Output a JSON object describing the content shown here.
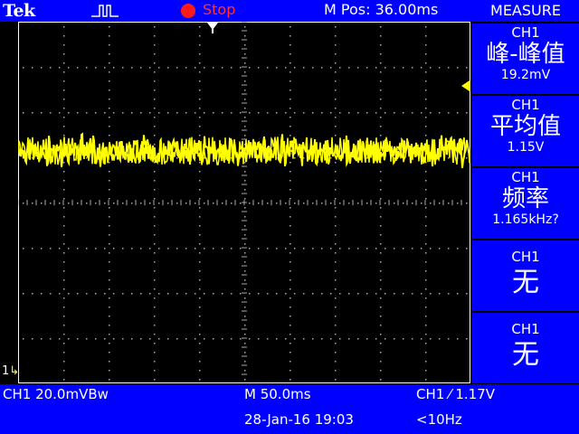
{
  "header": {
    "brand": "Tek",
    "trigger_state": "Stop",
    "position": "M Pos: 36.00ms"
  },
  "measure": {
    "title": "MEASURE",
    "items": [
      {
        "channel": "CH1",
        "label": "峰-峰值",
        "value": "19.2mV"
      },
      {
        "channel": "CH1",
        "label": "平均值",
        "value": "1.15V"
      },
      {
        "channel": "CH1",
        "label": "频率",
        "value": "1.165kHz?"
      },
      {
        "channel": "CH1",
        "label": "无",
        "value": ""
      },
      {
        "channel": "CH1",
        "label": "无",
        "value": ""
      }
    ]
  },
  "footer": {
    "ch1_scale": "CH1  20.0mVBw",
    "timebase": "M 50.0ms",
    "trigger": "CH1 ⁄ 1.17V",
    "datetime": "28-Jan-16 19:03",
    "trigger_freq": "<10Hz"
  },
  "markers": {
    "channel_marker": "1"
  },
  "colors": {
    "panel": "#0000ff",
    "trace": "#ffff00",
    "stop": "#ff1a1a"
  },
  "trace": {
    "level_divisions": 2.86,
    "noise_pp_divisions": 0.96
  }
}
